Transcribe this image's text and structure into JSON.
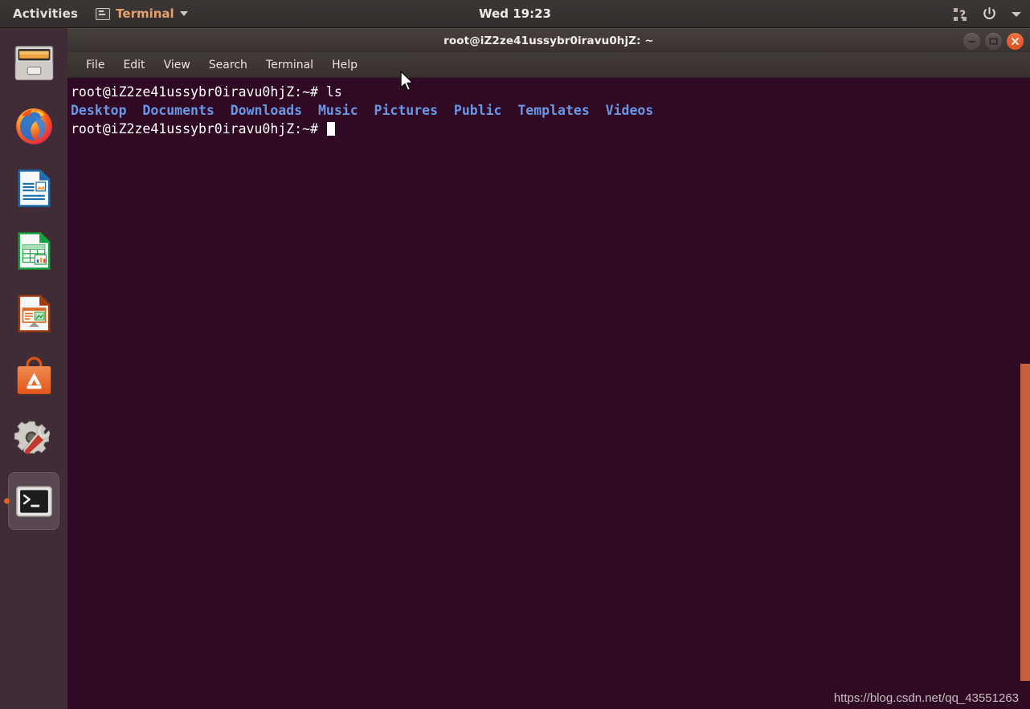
{
  "top_panel": {
    "activities_label": "Activities",
    "app_menu": {
      "icon": "terminal-icon",
      "label": "Terminal",
      "caret": "chevron-down-icon"
    },
    "clock": "Wed 19:23",
    "tray_icons": [
      "accessibility-icon",
      "power-icon",
      "chevron-down-icon"
    ]
  },
  "dock": {
    "items": [
      {
        "name": "files",
        "icon": "file-cabinet-icon",
        "active": false
      },
      {
        "name": "firefox",
        "icon": "firefox-icon",
        "active": false
      },
      {
        "name": "libreoffice-writer",
        "icon": "writer-icon",
        "active": false
      },
      {
        "name": "libreoffice-calc",
        "icon": "calc-icon",
        "active": false
      },
      {
        "name": "libreoffice-impress",
        "icon": "impress-icon",
        "active": false
      },
      {
        "name": "ubuntu-software",
        "icon": "software-bag-icon",
        "active": false
      },
      {
        "name": "settings",
        "icon": "gear-wrench-icon",
        "active": false
      },
      {
        "name": "terminal",
        "icon": "terminal-icon",
        "active": true
      }
    ]
  },
  "window": {
    "title": "root@iZ2ze41ussybr0iravu0hjZ: ~",
    "buttons": {
      "minimize": "minimize-icon",
      "maximize": "maximize-icon",
      "close": "close-icon"
    },
    "menu": [
      "File",
      "Edit",
      "View",
      "Search",
      "Terminal",
      "Help"
    ]
  },
  "terminal": {
    "background": "#300a24",
    "prompt_color": "#ffffff",
    "dir_color": "#6a97e5",
    "lines": [
      {
        "type": "command",
        "prompt": "root@iZ2ze41ussybr0iravu0hjZ:~# ",
        "command": "ls"
      },
      {
        "type": "output",
        "entries": [
          "Desktop",
          "Documents",
          "Downloads",
          "Music",
          "Pictures",
          "Public",
          "Templates",
          "Videos"
        ]
      },
      {
        "type": "prompt",
        "prompt": "root@iZ2ze41ussybr0iravu0hjZ:~# ",
        "cursor": true
      }
    ]
  },
  "watermark": "https://blog.csdn.net/qq_43551263",
  "scrollbar": {
    "color": "#c9603c"
  }
}
